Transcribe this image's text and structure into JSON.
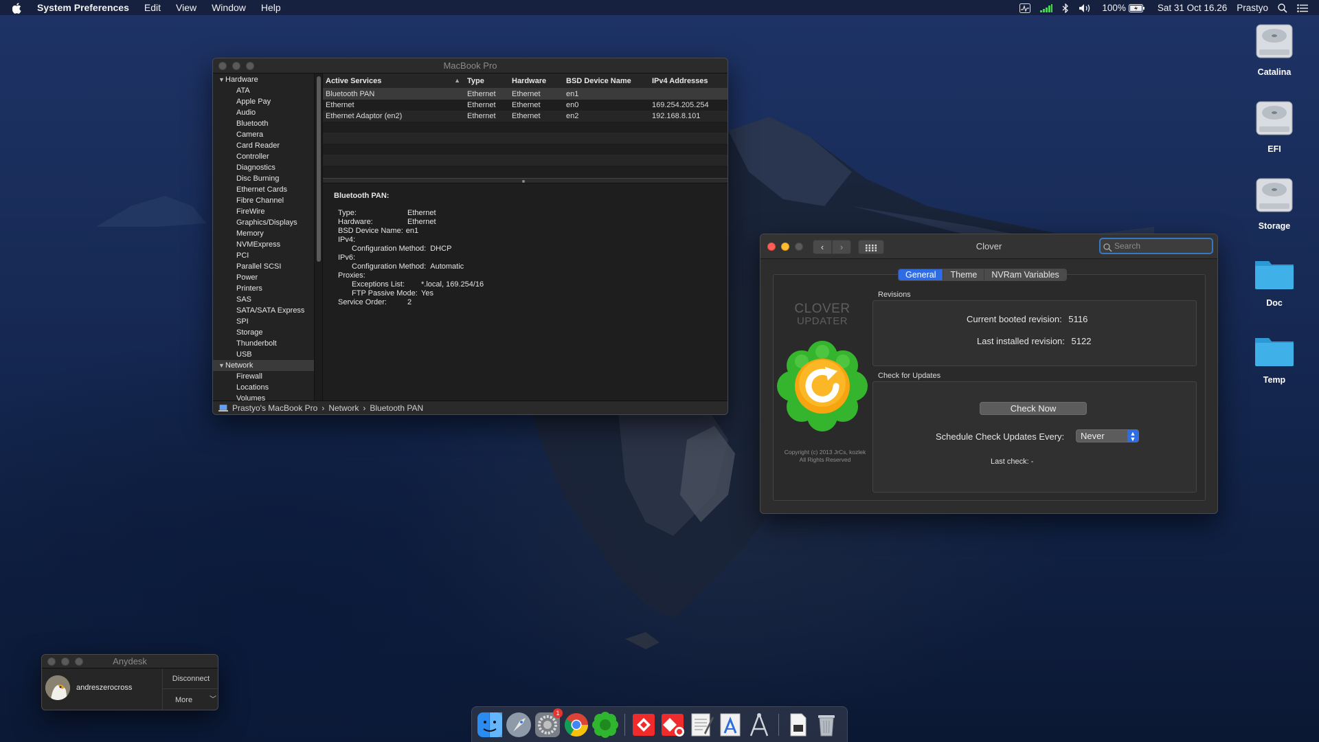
{
  "menubar": {
    "app": "System Preferences",
    "items": [
      "Edit",
      "View",
      "Window",
      "Help"
    ],
    "battery": "100%",
    "datetime": "Sat 31 Oct 16.26",
    "user": "Prastyo"
  },
  "sysinfo": {
    "title": "MacBook Pro",
    "sidebar": {
      "hardware_label": "Hardware",
      "hardware_items": [
        "ATA",
        "Apple Pay",
        "Audio",
        "Bluetooth",
        "Camera",
        "Card Reader",
        "Controller",
        "Diagnostics",
        "Disc Burning",
        "Ethernet Cards",
        "Fibre Channel",
        "FireWire",
        "Graphics/Displays",
        "Memory",
        "NVMExpress",
        "PCI",
        "Parallel SCSI",
        "Power",
        "Printers",
        "SAS",
        "SATA/SATA Express",
        "SPI",
        "Storage",
        "Thunderbolt",
        "USB"
      ],
      "network_label": "Network",
      "network_items": [
        "Firewall",
        "Locations",
        "Volumes"
      ]
    },
    "table": {
      "headers": [
        "Active Services",
        "Type",
        "Hardware",
        "BSD Device Name",
        "IPv4 Addresses"
      ],
      "rows": [
        [
          "Bluetooth PAN",
          "Ethernet",
          "Ethernet",
          "en1",
          ""
        ],
        [
          "Ethernet",
          "Ethernet",
          "Ethernet",
          "en0",
          "169.254.205.254"
        ],
        [
          "Ethernet Adaptor (en2)",
          "Ethernet",
          "Ethernet",
          "en2",
          "192.168.8.101"
        ]
      ]
    },
    "detail": {
      "title": "Bluetooth PAN:",
      "type_k": "Type:",
      "type_v": "Ethernet",
      "hw_k": "Hardware:",
      "hw_v": "Ethernet",
      "bsd_k": "BSD Device Name:",
      "bsd_v": "en1",
      "ipv4_k": "IPv4:",
      "ipv4_cfg_k": "Configuration Method:",
      "ipv4_cfg_v": "DHCP",
      "ipv6_k": "IPv6:",
      "ipv6_cfg_k": "Configuration Method:",
      "ipv6_cfg_v": "Automatic",
      "proxies_k": "Proxies:",
      "exc_k": "Exceptions List:",
      "exc_v": "*.local, 169.254/16",
      "ftp_k": "FTP Passive Mode:",
      "ftp_v": "Yes",
      "order_k": "Service Order:",
      "order_v": "2"
    },
    "status": {
      "computer": "Prastyo's MacBook Pro",
      "sep1": "›",
      "section": "Network",
      "sep2": "›",
      "item": "Bluetooth PAN"
    }
  },
  "clover": {
    "title": "Clover",
    "search_placeholder": "Search",
    "tabs": [
      "General",
      "Theme",
      "NVRam Variables"
    ],
    "logo_line1": "CLOVER",
    "logo_line2": "UPDATER",
    "copyright_1": "Copyright (c) 2013 JrCs, kozlek",
    "copyright_2": "All Rights Reserved",
    "revisions_label": "Revisions",
    "current_label": "Current booted revision:",
    "current_value": "5116",
    "installed_label": "Last installed revision:",
    "installed_value": "5122",
    "updates_label": "Check for Updates",
    "check_now": "Check Now",
    "schedule_label": "Schedule Check Updates Every:",
    "schedule_value": "Never",
    "last_check": "Last check: -"
  },
  "desktop_icons": [
    "Catalina",
    "EFI",
    "Storage",
    "Doc",
    "Temp"
  ],
  "anydesk": {
    "title": "Anydesk",
    "user": "andreszerocross",
    "disconnect": "Disconnect",
    "more": "More"
  },
  "dock": {
    "badge": "1",
    "apps": [
      "finder-icon",
      "launchpad-icon",
      "system-preferences-icon",
      "chrome-icon",
      "clover-icon",
      "anydesk-icon",
      "anydesk-alt-icon",
      "textedit-icon",
      "xcode-icon",
      "hackintool-icon",
      "files-icon",
      "trash-icon"
    ]
  },
  "colors": {
    "accent": "#2f6ce4",
    "close": "#ff5f57",
    "minimize": "#febc2e",
    "folder": "#3fb0e8"
  }
}
